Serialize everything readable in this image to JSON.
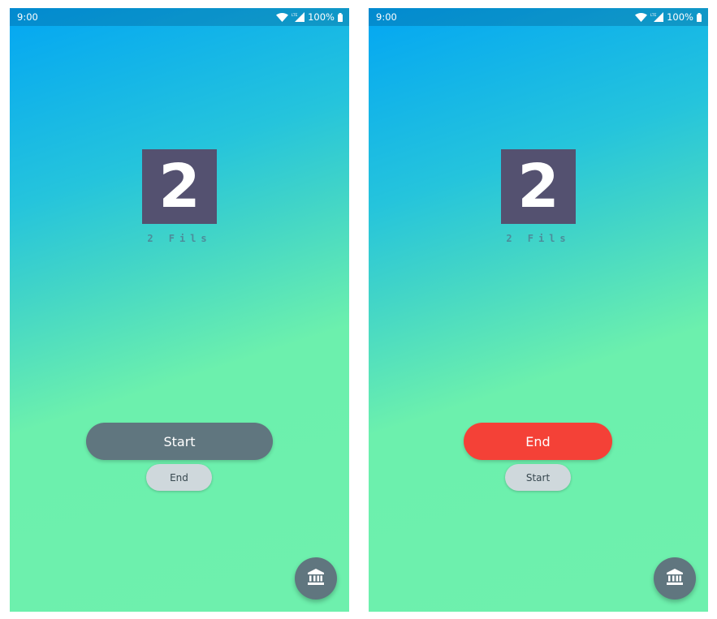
{
  "screens": [
    {
      "status_bar": {
        "time": "9:00",
        "battery": "100%"
      },
      "coin": {
        "value": "2",
        "label": "2 Fils"
      },
      "primary_button": {
        "label": "Start",
        "color": "#60767f"
      },
      "secondary_button": {
        "label": "End"
      },
      "fab": {
        "icon": "bank-icon"
      }
    },
    {
      "status_bar": {
        "time": "9:00",
        "battery": "100%"
      },
      "coin": {
        "value": "2",
        "label": "2 Fils"
      },
      "primary_button": {
        "label": "End",
        "color": "#f44137"
      },
      "secondary_button": {
        "label": "Start"
      },
      "fab": {
        "icon": "bank-icon"
      }
    }
  ],
  "colors": {
    "gradient_top": "#03a6f3",
    "gradient_bottom": "#6ef0ad",
    "coin_tile": "#545170",
    "coin_label": "#4d8c9a",
    "secondary_button": "#cfd8dc"
  }
}
